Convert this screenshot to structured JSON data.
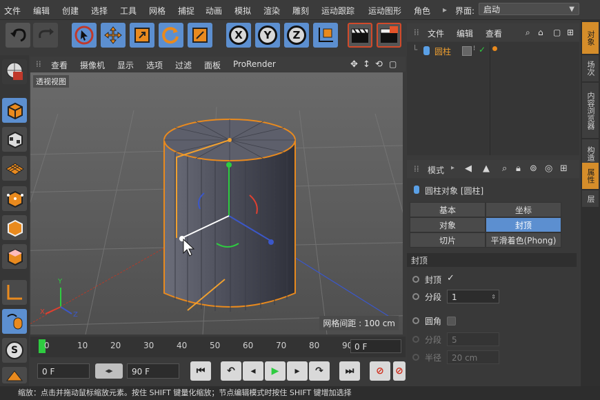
{
  "menu": [
    "文件",
    "编辑",
    "创建",
    "选择",
    "工具",
    "网格",
    "捕捉",
    "动画",
    "模拟",
    "渲染",
    "雕刻",
    "运动跟踪",
    "运动图形",
    "角色"
  ],
  "layout": {
    "label": "界面:",
    "value": "启动"
  },
  "toolbar": {
    "axis_x": "X",
    "axis_y": "Y",
    "axis_z": "Z"
  },
  "viewport_menu": [
    "查看",
    "摄像机",
    "显示",
    "选项",
    "过滤",
    "面板",
    "ProRender"
  ],
  "viewport": {
    "label": "透视视图",
    "grid_spacing": "网格间距 : 100 cm",
    "axis_y": "Y",
    "axis_x": "X",
    "axis_z": "Z"
  },
  "timeline": {
    "ticks": [
      "0",
      "10",
      "20",
      "30",
      "40",
      "50",
      "60",
      "70",
      "80",
      "90"
    ],
    "current_frame": "0 F"
  },
  "transport": {
    "start": "0 F",
    "end": "90 F"
  },
  "status": "缩放：点击并拖动鼠标缩放元素。按住 SHIFT 键量化缩放；节点编辑模式时按住 SHIFT 键增加选择",
  "object_manager": {
    "menu": [
      "文件",
      "编辑",
      "查看"
    ],
    "objects": [
      {
        "name": "圆柱"
      }
    ]
  },
  "attribute_manager": {
    "mode_label": "模式",
    "title": "圆柱对象 [圆柱]",
    "tabs": [
      {
        "label": "基本",
        "active": false
      },
      {
        "label": "坐标",
        "active": false
      },
      {
        "label": "对象",
        "active": false
      },
      {
        "label": "封顶",
        "active": true
      },
      {
        "label": "切片",
        "active": false
      },
      {
        "label": "平滑着色(Phong)",
        "active": false
      }
    ],
    "section": "封顶",
    "props": {
      "caps": {
        "label": "封顶",
        "checked": "✓"
      },
      "segments": {
        "label": "分段",
        "value": "1"
      },
      "fillet": {
        "label": "圆角"
      },
      "fillet_segments": {
        "label": "分段",
        "value": "5"
      },
      "radius": {
        "label": "半径",
        "value": "20 cm"
      }
    }
  },
  "side_tabs": [
    "对象",
    "场次",
    "内容浏览器",
    "构造",
    "属性",
    "层"
  ]
}
